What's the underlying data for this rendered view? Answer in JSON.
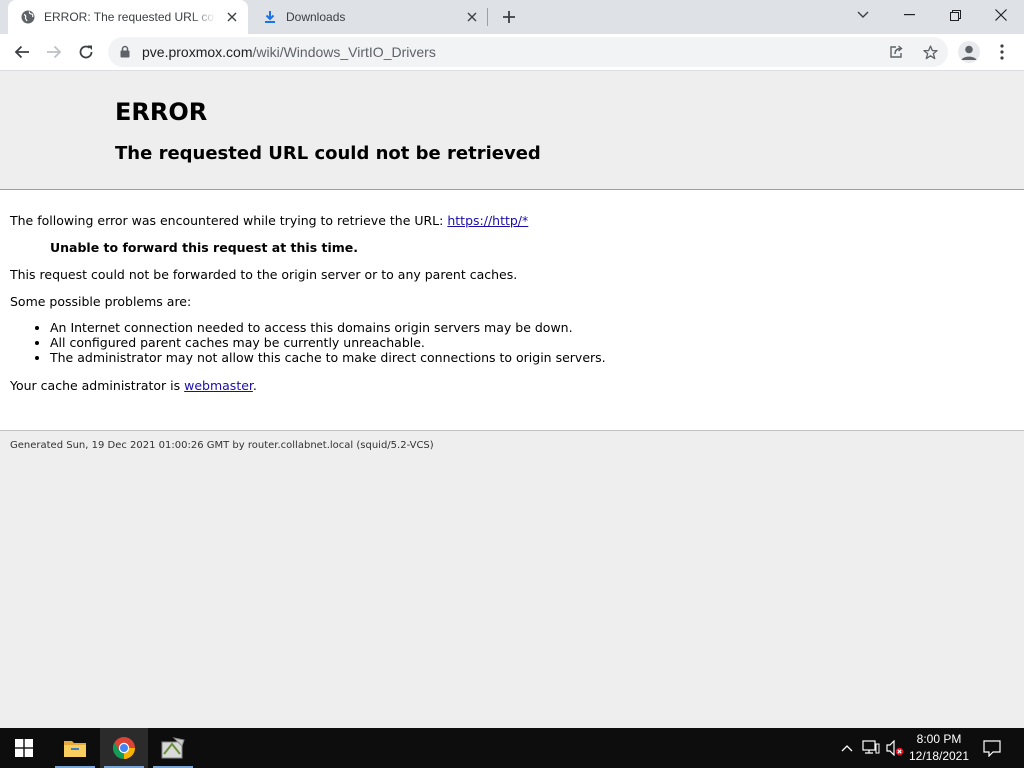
{
  "browser": {
    "tabs": [
      {
        "title": "ERROR: The requested URL could not be retrieved",
        "icon": "globe-icon",
        "active": true
      },
      {
        "title": "Downloads",
        "icon": "download-icon",
        "active": false
      }
    ],
    "address": {
      "host": "pve.proxmox.com",
      "path": "/wiki/Windows_VirtIO_Drivers"
    }
  },
  "page": {
    "heading": "ERROR",
    "subheading": "The requested URL could not be retrieved",
    "intro_text": "The following error was encountered while trying to retrieve the URL: ",
    "intro_link": "https://http/*",
    "error_message": "Unable to forward this request at this time.",
    "detail": "This request could not be forwarded to the origin server or to any parent caches.",
    "problems_intro": "Some possible problems are:",
    "problems": [
      "An Internet connection needed to access this domains origin servers may be down.",
      "All configured parent caches may be currently unreachable.",
      "The administrator may not allow this cache to make direct connections to origin servers."
    ],
    "admin_text": "Your cache administrator is ",
    "admin_link": "webmaster",
    "admin_suffix": ".",
    "footer": "Generated Sun, 19 Dec 2021 01:00:26 GMT by router.collabnet.local (squid/5.2-VCS)"
  },
  "taskbar": {
    "time": "8:00 PM",
    "date": "12/18/2021"
  },
  "colors": {
    "link": "#1a0dab",
    "tabstrip": "#dee1e6",
    "taskbar": "#0d0d0d"
  }
}
